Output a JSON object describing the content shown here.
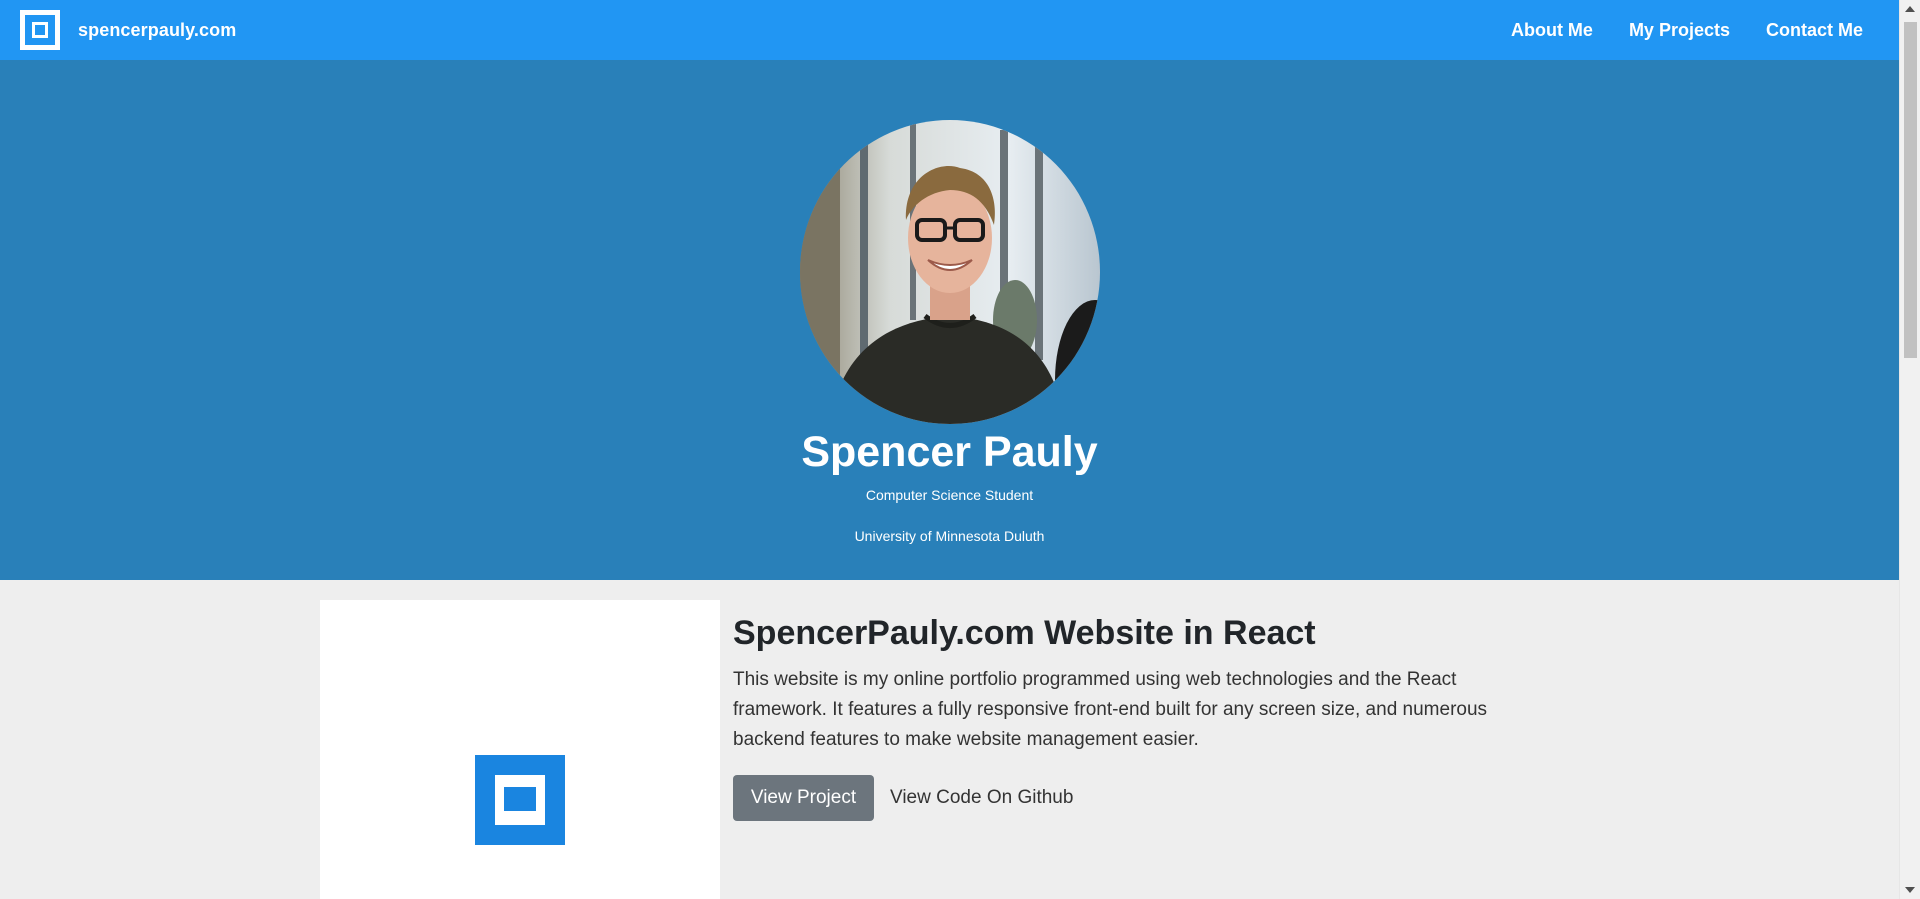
{
  "navbar": {
    "brand": "spencerpauly.com",
    "logo_icon": "spencerpauly-logo-icon",
    "links": [
      "About Me",
      "My Projects",
      "Contact Me"
    ]
  },
  "hero": {
    "name": "Spencer Pauly",
    "role": "Computer Science Student",
    "school": "University of Minnesota Duluth"
  },
  "project": {
    "title": "SpencerPauly.com Website in React",
    "description": "This website is my online portfolio programmed using web technologies and the React framework. It features a fully responsive front-end built for any screen size, and numerous backend features to make website management easier.",
    "view_button": "View Project",
    "github_link": "View Code On Github"
  },
  "colors": {
    "navbar": "#2196f3",
    "hero": "#2980b9",
    "page_bg": "#eeeeee",
    "logo_blue": "#1a85e0",
    "button_gray": "#6c757d"
  }
}
